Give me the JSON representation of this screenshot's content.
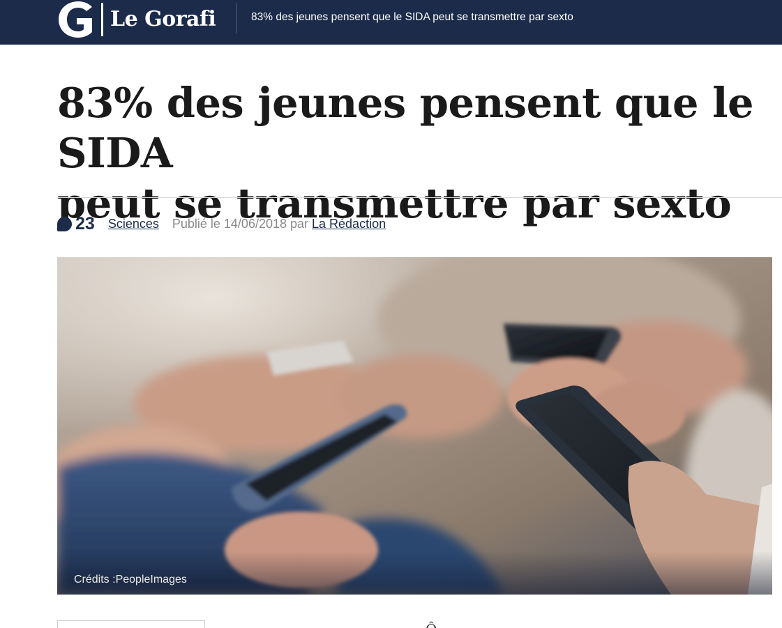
{
  "header": {
    "logo_text": "Le Gorafi",
    "headline": "83% des jeunes pensent que le SIDA peut se transmettre par sexto",
    "background_color": "#1c2b4a"
  },
  "article": {
    "title_line1": "83% des jeunes pensent que le SIDA",
    "title_line2": "peut se transmettre par sexto",
    "comment_count": "23",
    "category": "Sciences",
    "published_label": "Publié le 14/06/2018 par",
    "author": "La Rédaction",
    "image_credit": "Crédits :PeopleImages",
    "image_description_icon": "photo-of-hands-holding-smartphones",
    "body_preview": "Ô"
  },
  "colors": {
    "accent": "#1c2b4a",
    "muted_text": "#8a8a8a",
    "rule": "#d9d9d9"
  }
}
